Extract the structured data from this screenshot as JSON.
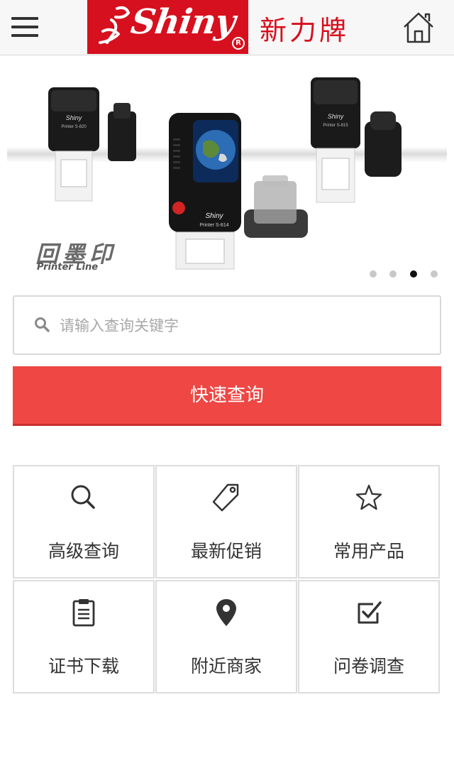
{
  "header": {
    "logo_text": "Shiny",
    "logo_reg": "R",
    "brand_cn": "新力牌"
  },
  "banner": {
    "title_cn": "回墨印",
    "title_en": "Printer Line",
    "products": [
      {
        "model": "Printer S-820"
      },
      {
        "model": "Printer S-814"
      },
      {
        "model": "Printer S-815"
      }
    ],
    "product_brand": "Shiny",
    "active_slide": 3,
    "slide_count": 4
  },
  "search": {
    "placeholder": "请输入查询关键字",
    "value": ""
  },
  "quick_search": {
    "label": "快速查询"
  },
  "menu": [
    {
      "label": "高级查询",
      "icon": "search-icon"
    },
    {
      "label": "最新促销",
      "icon": "price-tag-icon"
    },
    {
      "label": "常用产品",
      "icon": "star-icon"
    },
    {
      "label": "证书下载",
      "icon": "clipboard-icon"
    },
    {
      "label": "附近商家",
      "icon": "map-pin-icon"
    },
    {
      "label": "问卷调查",
      "icon": "checkbox-icon"
    }
  ],
  "colors": {
    "brand_red": "#d6101e",
    "button_red": "#ee4744",
    "active_dot": "#111111",
    "inactive_dot": "#c8c8c8"
  }
}
